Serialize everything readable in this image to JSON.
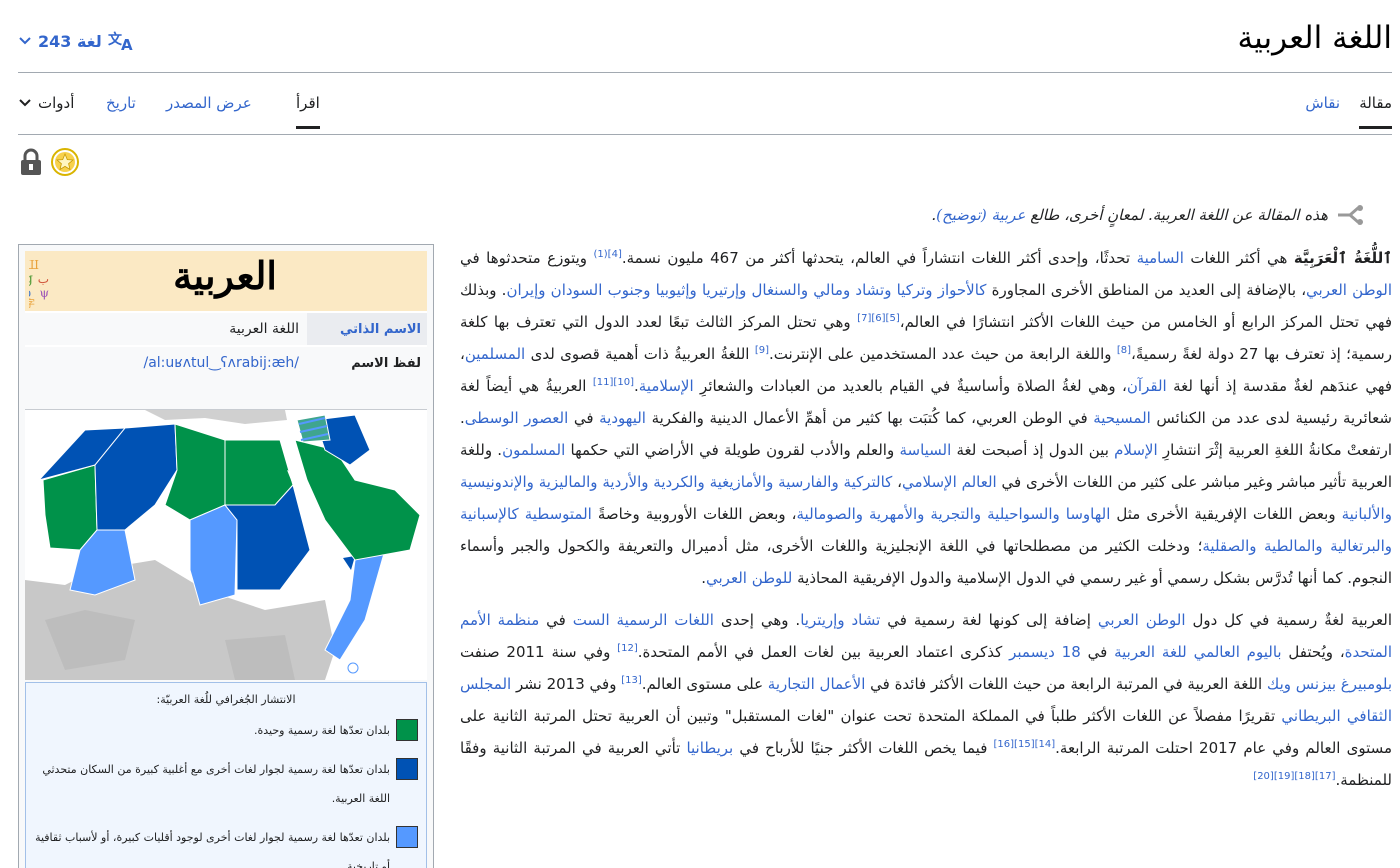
{
  "header": {
    "title": "اللغة العربية",
    "languages": "243 لغة"
  },
  "tabs": {
    "article": "مقالة",
    "talk": "نقاش",
    "read": "اقرأ",
    "view_source": "عرض المصدر",
    "history": "تاريخ",
    "tools": "أدوات"
  },
  "hatnote": {
    "prefix": "هذه المقالة عن اللغة العربية. لمعانٍ أخرى، طالع",
    "link1": "عربية",
    "link2": "(توضيح)",
    "suffix": "."
  },
  "infobox": {
    "name": "العربية",
    "rows": [
      {
        "key": "الاسم الذاتي",
        "value": "اللغة العربية"
      },
      {
        "key": "لفظ الاسم",
        "value": "/al:uʁʌtul‿ʕʌrabij:æh/"
      }
    ],
    "legend_caption": "الانتشار الجُغرافي للُغة العربيّة:",
    "legend": [
      {
        "text": "بلدان تعدّها لغة رسمية وحيدة.",
        "color": "#00924a"
      },
      {
        "text": "بلدان تعدّها لغة رسمية لجوار لغات أخرى مع أغلبية كبيرة من السكان متحدثي اللغة العربية.",
        "color": "#0052b4"
      },
      {
        "text": "بلدان تعدّها لغة رسمية لجوار لغات أخرى لوجود أقليات كبيرة، أو لأسباب ثقافية أو تاريخية.",
        "color": "#5599ff"
      }
    ]
  },
  "colors": {
    "link": "#3366cc",
    "green": "#00924a",
    "blue": "#0052b4",
    "lightblue": "#5599ff",
    "gray": "#c8c8c8"
  },
  "body": {
    "p1": [
      {
        "t": "ٱللُّغَةُ ٱلْعَرَبِيَّة",
        "b": true
      },
      {
        "t": " هي أكثر اللغات "
      },
      {
        "t": "السامية",
        "l": true
      },
      {
        "t": " تحدثًا، وإحدى أكثر اللغات انتشاراً في العالم، يتحدثها أكثر من 467 مليون نسمة."
      },
      {
        "t": "[4](1)",
        "s": true
      },
      {
        "t": " ويتوزع متحدثوها في "
      },
      {
        "t": "الوطن العربي",
        "l": true
      },
      {
        "t": "، بالإضافة إلى العديد من المناطق الأخرى المجاورة "
      },
      {
        "t": "كالأحواز وتركيا وتشاد ومالي والسنغال وإرتيريا وإثيوبيا وجنوب السودان وإيران",
        "l": true
      },
      {
        "t": ". وبذلك فهي تحتل المركز الرابع أو الخامس من حيث اللغات الأكثر انتشارًا في العالم،"
      },
      {
        "t": "[5][6][7]",
        "s": true
      },
      {
        "t": " وهي تحتل المركز الثالث تبعًا لعدد الدول التي تعترف بها كلغة رسمية؛ إذ تعترف بها 27 دولة لغةً رسميةً،"
      },
      {
        "t": "[8]",
        "s": true
      },
      {
        "t": " واللغة الرابعة من حيث عدد المستخدمين على الإنترنت."
      },
      {
        "t": "[9]",
        "s": true
      },
      {
        "t": " اللغةُ العربيةُ ذات أهمية قصوى لدى "
      },
      {
        "t": "المسلمين",
        "l": true
      },
      {
        "t": "، فهي عندَهم لغةٌ مقدسة إذ أنها لغة "
      },
      {
        "t": "القرآن",
        "l": true
      },
      {
        "t": "، وهي لغةُ الصلاة وأساسيةٌ في القيام بالعديد من العبادات والشعائرِ "
      },
      {
        "t": "الإسلامية",
        "l": true
      },
      {
        "t": "."
      },
      {
        "t": "[10][11]",
        "s": true
      },
      {
        "t": " العربيةُ هي أيضاً لغة شعائرية رئيسية لدى عدد من الكنائس "
      },
      {
        "t": "المسيحية",
        "l": true
      },
      {
        "t": " في الوطن العربي، كما كُتبَت بها كثير من أهمِّ الأعمال الدينية والفكرية "
      },
      {
        "t": "اليهودية",
        "l": true
      },
      {
        "t": " في "
      },
      {
        "t": "العصور الوسطى",
        "l": true
      },
      {
        "t": ". ارتفعتْ مكانةُ اللغةِ العربية إثْرَ انتشارِ "
      },
      {
        "t": "الإسلام",
        "l": true
      },
      {
        "t": " بين الدول إذ أصبحت لغة "
      },
      {
        "t": "السياسة",
        "l": true
      },
      {
        "t": " والعلم والأدب لقرون طويلة في الأراضي التي حكمها "
      },
      {
        "t": "المسلمون",
        "l": true
      },
      {
        "t": ". وللغة العربية تأثير مباشر وغير مباشر على كثير من اللغات الأخرى في "
      },
      {
        "t": "العالم الإسلامي",
        "l": true
      },
      {
        "t": "، "
      },
      {
        "t": "كالتركية والفارسية والأمازيغية والكردية والأردية والماليزية والإندونيسية والألبانية",
        "l": true
      },
      {
        "t": " وبعض اللغات الإفريقية الأخرى مثل "
      },
      {
        "t": "الهاوسا والسواحيلية والتجرية والأمهرية والصومالية",
        "l": true
      },
      {
        "t": "، وبعض اللغات الأوروبية وخاصةً "
      },
      {
        "t": "المتوسطية كالإسبانية والبرتغالية والمالطية والصقلية",
        "l": true
      },
      {
        "t": "؛ ودخلت الكثير من مصطلحاتها في اللغة الإنجليزية واللغات الأخرى، مثل أدميرال والتعريفة والكحول والجبر وأسماء النجوم. كما أنها تُدرَّس بشكل رسمي أو غير رسمي في الدول الإسلامية والدول الإفريقية المحاذية "
      },
      {
        "t": "للوطن العربي",
        "l": true
      },
      {
        "t": "."
      }
    ],
    "p2": [
      {
        "t": "العربية لغةٌ رسمية في كل دول "
      },
      {
        "t": "الوطن العربي",
        "l": true
      },
      {
        "t": " إضافة إلى كونها لغة رسمية في "
      },
      {
        "t": "تشاد وإريتريا",
        "l": true
      },
      {
        "t": ". وهي إحدى "
      },
      {
        "t": "اللغات الرسمية الست",
        "l": true
      },
      {
        "t": " في "
      },
      {
        "t": "منظمة الأمم المتحدة",
        "l": true
      },
      {
        "t": "، ويُحتفل "
      },
      {
        "t": "باليوم العالمي للغة العربية",
        "l": true
      },
      {
        "t": " في "
      },
      {
        "t": "18 ديسمبر",
        "l": true
      },
      {
        "t": " كذكرى اعتماد العربية بين لغات العمل في الأمم المتحدة."
      },
      {
        "t": "[12]",
        "s": true
      },
      {
        "t": " وفي سنة 2011 صنفت "
      },
      {
        "t": "بلومبيرغ بيزنس ويك",
        "l": true
      },
      {
        "t": " اللغة العربية في المرتبة الرابعة من حيث اللغات الأكثر فائدة في "
      },
      {
        "t": "الأعمال التجارية",
        "l": true
      },
      {
        "t": " على مستوى العالم."
      },
      {
        "t": "[13]",
        "s": true
      },
      {
        "t": " وفي 2013 نشر "
      },
      {
        "t": "المجلس الثقافي البريطاني",
        "l": true
      },
      {
        "t": " تقريرًا مفصلاً عن اللغات الأكثر طلباً في المملكة المتحدة تحت عنوان \"لغات المستقبل\" وتبين أن العربية تحتل المرتبة الثانية على مستوى العالم وفي عام 2017 احتلت المرتبة الرابعة."
      },
      {
        "t": "[14][15][16]",
        "s": true
      },
      {
        "t": " فيما يخص اللغات الأكثر جنيًا للأرباح في "
      },
      {
        "t": "بريطانيا",
        "l": true
      },
      {
        "t": " تأتي العربية في المرتبة الثانية وفقًا للمنظمة."
      },
      {
        "t": "[17][18][19][20]",
        "s": true
      }
    ]
  }
}
